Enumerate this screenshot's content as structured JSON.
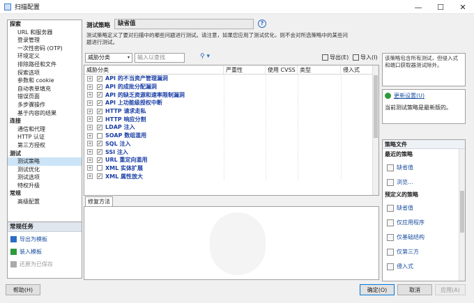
{
  "window": {
    "title": "扫描配置"
  },
  "window_controls": {
    "minimize": "—",
    "maximize": "☐",
    "close": "✕"
  },
  "nav": {
    "items": [
      {
        "label": "探索",
        "type": "cat"
      },
      {
        "label": "URL 和服务器",
        "type": "sub"
      },
      {
        "label": "登录管理",
        "type": "sub"
      },
      {
        "label": "一次性密码 (OTP)",
        "type": "sub"
      },
      {
        "label": "环境定义",
        "type": "sub"
      },
      {
        "label": "排除路径和文件",
        "type": "sub"
      },
      {
        "label": "探索选项",
        "type": "sub"
      },
      {
        "label": "参数和 cookie",
        "type": "sub"
      },
      {
        "label": "自动表单填充",
        "type": "sub"
      },
      {
        "label": "错误页面",
        "type": "sub"
      },
      {
        "label": "多步骤操作",
        "type": "sub"
      },
      {
        "label": "基于内容的结果",
        "type": "sub"
      },
      {
        "label": "连接",
        "type": "cat"
      },
      {
        "label": "通信和代理",
        "type": "sub"
      },
      {
        "label": "HTTP 认证",
        "type": "sub"
      },
      {
        "label": "第三方授权",
        "type": "sub"
      },
      {
        "label": "测试",
        "type": "cat"
      },
      {
        "label": "测试策略",
        "type": "sub",
        "selected": true
      },
      {
        "label": "测试优化",
        "type": "sub"
      },
      {
        "label": "测试选项",
        "type": "sub"
      },
      {
        "label": "特权升级",
        "type": "sub"
      },
      {
        "label": "常规",
        "type": "cat"
      },
      {
        "label": "高级配置",
        "type": "sub"
      }
    ]
  },
  "tasks": {
    "header": "常规任务",
    "items": [
      {
        "label": "导出为模板",
        "disabled": false
      },
      {
        "label": "装入模板",
        "disabled": false
      },
      {
        "label": "还原为已保存",
        "disabled": true
      }
    ]
  },
  "policy": {
    "label": "测试策略",
    "value": "缺省值",
    "help": "?",
    "description": "测试策略定义了要对扫描中的哪些问题进行测试。请注意，如果您应用了测试优化，则不会对所选策略中的某些问题进行测试。"
  },
  "toolbar": {
    "group_by": "威胁分类",
    "search_placeholder": "输入以查找",
    "search_icon": "⚲ ▾",
    "export_label": "导出(E)",
    "import_label": "导入(I)",
    "arrow_icon": "▾"
  },
  "grid": {
    "columns": [
      "威胁分类",
      "严重性",
      "使用 CVSS",
      "类型",
      "侵入式"
    ],
    "rows": [
      {
        "label": "API 的不当资产管理漏洞",
        "checked": true
      },
      {
        "label": "API 的成批分配漏洞",
        "checked": true
      },
      {
        "label": "API 的缺乏资源和速率限制漏洞",
        "checked": true
      },
      {
        "label": "API 上功能级授权中断",
        "checked": true
      },
      {
        "label": "HTTP 请求走私",
        "checked": true
      },
      {
        "label": "HTTP 响应分割",
        "checked": true
      },
      {
        "label": "LDAP 注入",
        "checked": true
      },
      {
        "label": "SOAP 数组滥用",
        "checked": false
      },
      {
        "label": "SQL 注入",
        "checked": true
      },
      {
        "label": "SSI 注入",
        "checked": true
      },
      {
        "label": "URL 重定向滥用",
        "checked": true
      },
      {
        "label": "XML 实体扩展",
        "checked": false
      },
      {
        "label": "XML 属性放大",
        "checked": true
      }
    ]
  },
  "fix_tab": {
    "label": "修复方法"
  },
  "right": {
    "info": "该策略包含所有测试，但侵入式和端口获取器测试除外。",
    "update_link": "更新设置(U)",
    "update_status": "当前测试策略是最新版的。"
  },
  "policy_files": {
    "header": "策略文件",
    "recent_label": "最近的策略",
    "recent": [
      "缺省值",
      "浏览..."
    ],
    "predefined_label": "预定义的策略",
    "predefined": [
      "缺省值",
      "仅应用程序",
      "仅基础结构",
      "仅第三方",
      "侵入式"
    ]
  },
  "footer": {
    "help": "帮助(H)",
    "ok": "确定(O)",
    "cancel": "取消",
    "apply": "应用(A)"
  }
}
